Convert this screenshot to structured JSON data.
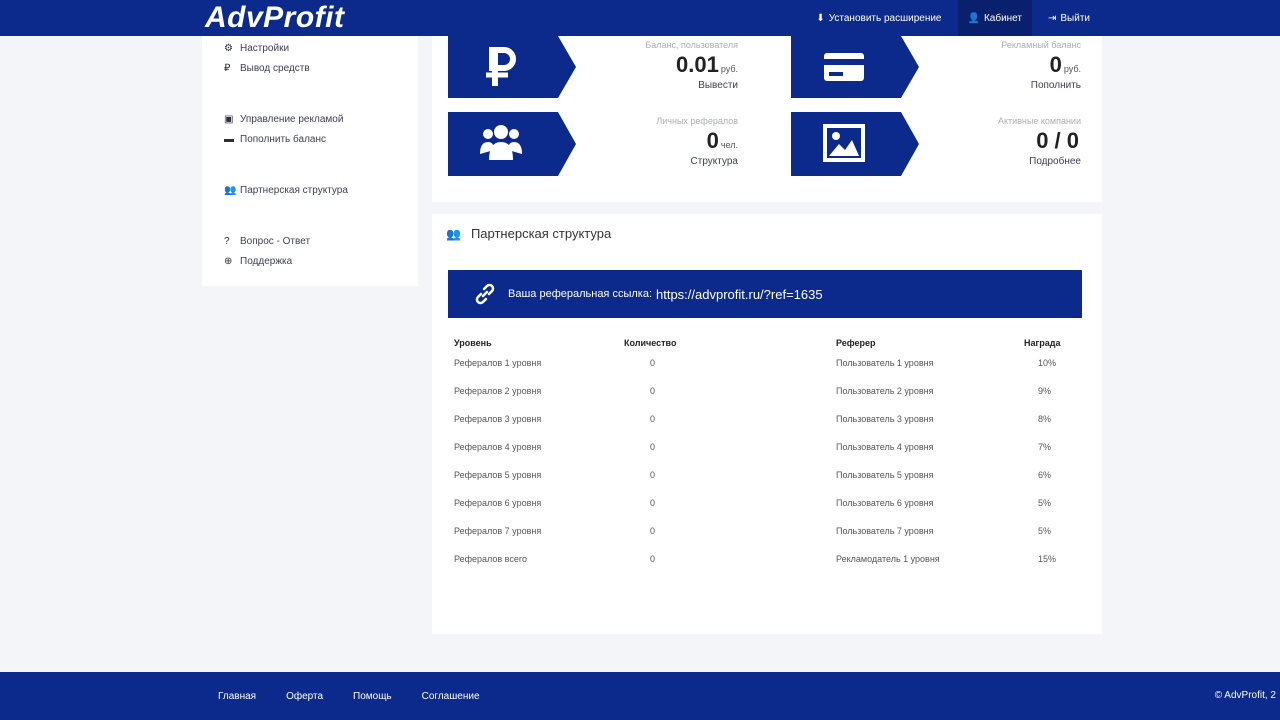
{
  "header": {
    "logo": "AdvProfit",
    "nav": [
      {
        "icon": "download-icon",
        "glyph": "⬇",
        "label": "Установить расширение"
      },
      {
        "icon": "user-icon",
        "glyph": "👤",
        "label": "Кабинет"
      },
      {
        "icon": "logout-icon",
        "glyph": "⇥",
        "label": "Выйти"
      }
    ]
  },
  "sidebar": {
    "group1": [
      {
        "icon": "gear-icon",
        "glyph": "⚙",
        "label": "Настройки"
      },
      {
        "icon": "ruble-icon",
        "glyph": "₽",
        "label": "Вывод средств"
      }
    ],
    "group2": [
      {
        "icon": "image-icon",
        "glyph": "▣",
        "label": "Управление рекламой"
      },
      {
        "icon": "credit-card-icon",
        "glyph": "▬",
        "label": "Пополнить баланс"
      }
    ],
    "group3": [
      {
        "icon": "users-icon",
        "glyph": "👥",
        "label": "Партнерская структура"
      }
    ],
    "group4": [
      {
        "icon": "question-icon",
        "glyph": "?",
        "label": "Вопрос - Ответ"
      },
      {
        "icon": "support-icon",
        "glyph": "⊕",
        "label": "Поддержка"
      }
    ]
  },
  "stats": {
    "balance": {
      "title": "Баланс, пользователя",
      "value": "0.01",
      "unit": "руб.",
      "link": "Вывести"
    },
    "ad_balance": {
      "title": "Рекламный баланс",
      "value": "0",
      "unit": "руб.",
      "link": "Пополнить"
    },
    "referrals": {
      "title": "Личных рефералов",
      "value": "0",
      "unit": "чел.",
      "link": "Структура"
    },
    "campaigns": {
      "title": "Активные компании",
      "value": "0 / 0",
      "unit": "",
      "link": "Подробнее"
    }
  },
  "partner": {
    "title": "Партнерская структура",
    "ref_label": "Ваша реферальная ссылка:",
    "ref_url": "https://advprofit.ru/?ref=1635",
    "columns": [
      "Уровень",
      "Количество",
      "Реферер",
      "Награда"
    ],
    "rows": [
      {
        "level": "Рефералов 1 уровня",
        "count": "0",
        "referer": "Пользователь 1 уровня",
        "reward": "10%"
      },
      {
        "level": "Рефералов 2 уровня",
        "count": "0",
        "referer": "Пользователь 2 уровня",
        "reward": "9%"
      },
      {
        "level": "Рефералов 3 уровня",
        "count": "0",
        "referer": "Пользователь 3 уровня",
        "reward": "8%"
      },
      {
        "level": "Рефералов 4 уровня",
        "count": "0",
        "referer": "Пользователь 4 уровня",
        "reward": "7%"
      },
      {
        "level": "Рефералов 5 уровня",
        "count": "0",
        "referer": "Пользователь 5 уровня",
        "reward": "6%"
      },
      {
        "level": "Рефералов 6 уровня",
        "count": "0",
        "referer": "Пользователь 6 уровня",
        "reward": "5%"
      },
      {
        "level": "Рефералов 7 уровня",
        "count": "0",
        "referer": "Пользователь 7 уровня",
        "reward": "5%"
      },
      {
        "level": "Рефералов всего",
        "count": "0",
        "referer": "Рекламодатель 1 уровня",
        "reward": "15%"
      }
    ]
  },
  "footer": {
    "links": [
      "Главная",
      "Оферта",
      "Помощь",
      "Соглашение"
    ],
    "copyright": "© AdvProfit, 2"
  },
  "colors": {
    "brand": "#0b2a8c",
    "background": "#f4f5f8"
  }
}
